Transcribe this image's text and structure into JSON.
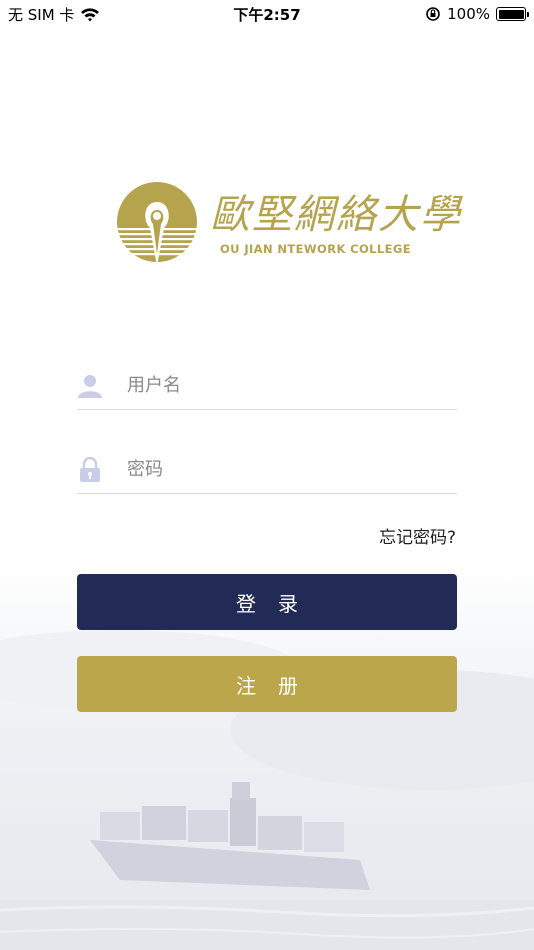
{
  "status_bar": {
    "carrier": "无 SIM 卡",
    "time": "下午2:57",
    "battery": "100%",
    "icons": [
      "wifi-icon",
      "orientation-lock-icon",
      "battery-icon"
    ]
  },
  "logo": {
    "name_cn": "歐堅網絡大學",
    "name_en": "OU JIAN NTEWORK COLLEGE",
    "color": "#b6a34d"
  },
  "form": {
    "username_placeholder": "用户名",
    "password_placeholder": "密码",
    "username_icon": "user-icon",
    "password_icon": "lock-icon"
  },
  "links": {
    "forgot_password": "忘记密码?"
  },
  "buttons": {
    "login_label": "登录",
    "register_label": "注册",
    "login_color": "#222b55",
    "register_color": "#bca64b"
  }
}
